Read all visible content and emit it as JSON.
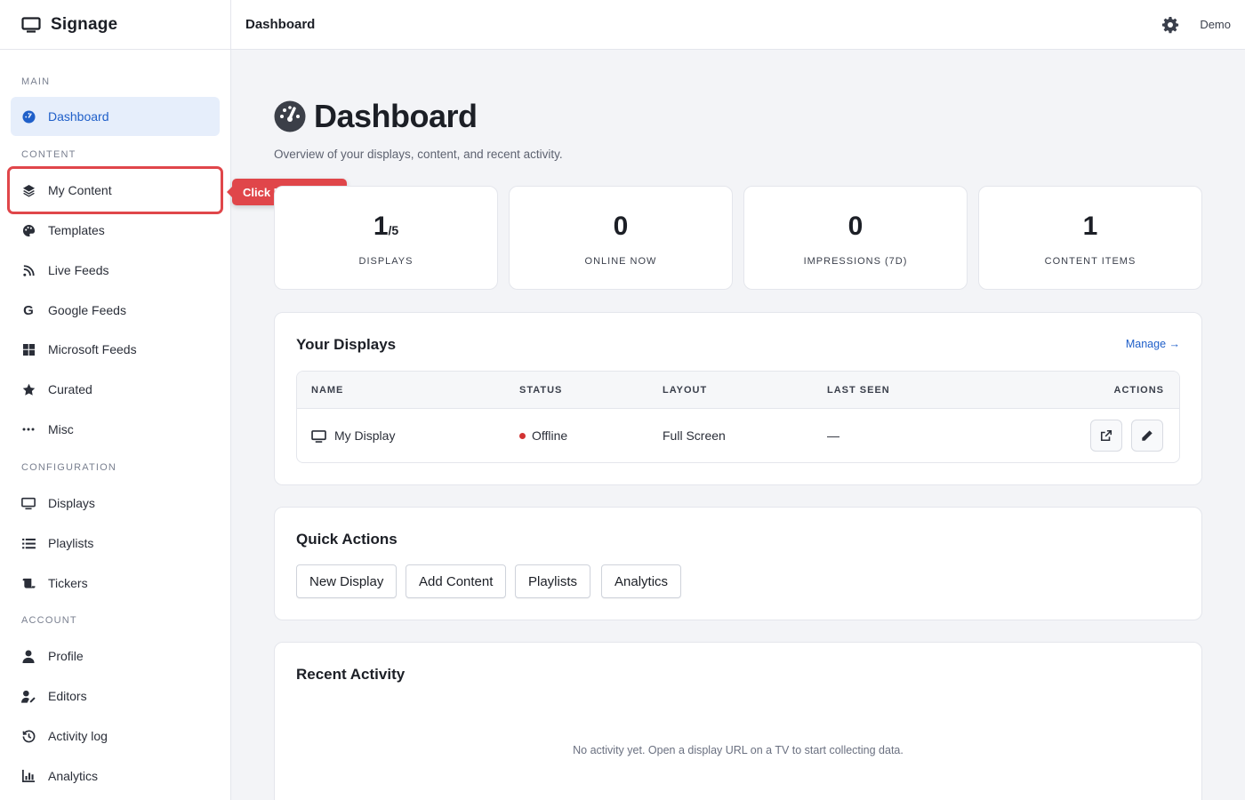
{
  "brand": {
    "name": "Signage",
    "icon": "monitor-icon"
  },
  "topbar": {
    "title": "Dashboard",
    "user": "Demo",
    "settings_icon": "gear-icon"
  },
  "sidebar": {
    "sections": {
      "main": "MAIN",
      "content": "CONTENT",
      "configuration": "CONFIGURATION",
      "account": "ACCOUNT"
    },
    "items": [
      {
        "label": "Dashboard",
        "icon": "gauge-icon",
        "active": true
      },
      {
        "label": "My Content",
        "icon": "layers-icon"
      },
      {
        "label": "Templates",
        "icon": "palette-icon"
      },
      {
        "label": "Live Feeds",
        "icon": "broadcast-icon"
      },
      {
        "label": "Google Feeds",
        "icon": "google-icon"
      },
      {
        "label": "Microsoft Feeds",
        "icon": "windows-icon"
      },
      {
        "label": "Curated",
        "icon": "star-icon"
      },
      {
        "label": "Misc",
        "icon": "ellipsis-icon"
      },
      {
        "label": "Displays",
        "icon": "monitor-icon"
      },
      {
        "label": "Playlists",
        "icon": "list-icon"
      },
      {
        "label": "Tickers",
        "icon": "scroll-icon"
      },
      {
        "label": "Profile",
        "icon": "user-icon"
      },
      {
        "label": "Editors",
        "icon": "user-edit-icon"
      },
      {
        "label": "Activity log",
        "icon": "history-icon"
      },
      {
        "label": "Analytics",
        "icon": "chart-icon"
      }
    ]
  },
  "tooltip": {
    "text": "Click My Content"
  },
  "page": {
    "title": "Dashboard",
    "subtitle": "Overview of your displays, content, and recent activity."
  },
  "stats": [
    {
      "value": "1",
      "suffix": "/5",
      "label": "DISPLAYS"
    },
    {
      "value": "0",
      "suffix": "",
      "label": "ONLINE NOW"
    },
    {
      "value": "0",
      "suffix": "",
      "label": "IMPRESSIONS (7D)"
    },
    {
      "value": "1",
      "suffix": "",
      "label": "CONTENT ITEMS"
    }
  ],
  "displays_card": {
    "title": "Your Displays",
    "manage_link": "Manage →",
    "columns": [
      "NAME",
      "STATUS",
      "LAYOUT",
      "LAST SEEN",
      "ACTIONS"
    ],
    "rows": [
      {
        "name": "My Display",
        "status": "Offline",
        "status_color": "#d23333",
        "layout": "Full Screen",
        "last_seen": "—"
      }
    ]
  },
  "quick_actions": {
    "title": "Quick Actions",
    "buttons": [
      "New Display",
      "Add Content",
      "Playlists",
      "Analytics"
    ]
  },
  "recent_activity": {
    "title": "Recent Activity",
    "empty_message": "No activity yet. Open a display URL on a TV to start collecting data."
  },
  "colors": {
    "accent": "#1f5fc9",
    "highlight": "#e0464a",
    "active_bg": "#e6eefb"
  }
}
